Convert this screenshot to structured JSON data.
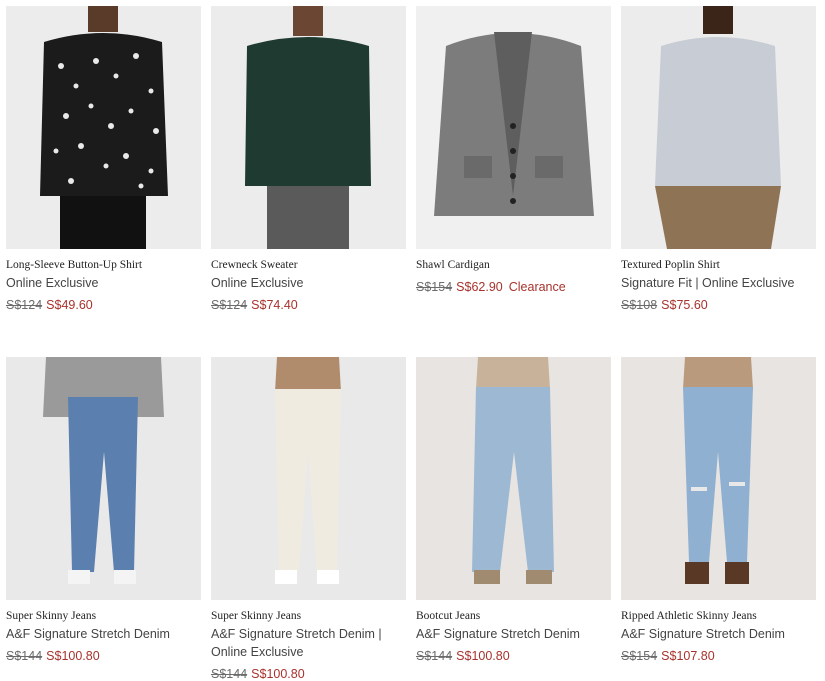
{
  "products": [
    {
      "name": "Long-Sleeve Button-Up Shirt",
      "sub": "Online Exclusive",
      "orig": "S$124",
      "sale": "S$49.60",
      "badge": ""
    },
    {
      "name": "Crewneck Sweater",
      "sub": "Online Exclusive",
      "orig": "S$124",
      "sale": "S$74.40",
      "badge": ""
    },
    {
      "name": "Shawl Cardigan",
      "sub": "",
      "orig": "S$154",
      "sale": "S$62.90",
      "badge": "Clearance"
    },
    {
      "name": "Textured Poplin Shirt",
      "sub": "Signature Fit | Online Exclusive",
      "orig": "S$108",
      "sale": "S$75.60",
      "badge": ""
    },
    {
      "name": "Super Skinny Jeans",
      "sub": "A&F Signature Stretch Denim",
      "orig": "S$144",
      "sale": "S$100.80",
      "badge": ""
    },
    {
      "name": "Super Skinny Jeans",
      "sub": "A&F Signature Stretch Denim | Online Exclusive",
      "orig": "S$144",
      "sale": "S$100.80",
      "badge": ""
    },
    {
      "name": "Bootcut Jeans",
      "sub": "A&F Signature Stretch Denim",
      "orig": "S$144",
      "sale": "S$100.80",
      "badge": ""
    },
    {
      "name": "Ripped Athletic Skinny Jeans",
      "sub": "A&F Signature Stretch Denim",
      "orig": "S$154",
      "sale": "S$107.80",
      "badge": ""
    }
  ]
}
